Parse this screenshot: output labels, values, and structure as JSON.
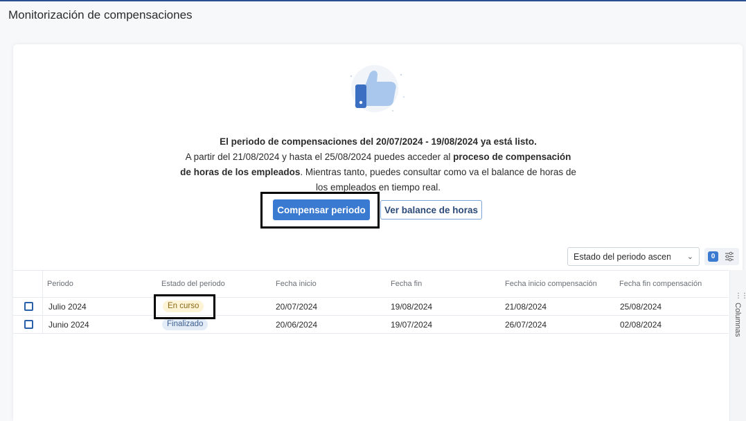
{
  "header": {
    "title": "Monitorización de compensaciones"
  },
  "banner": {
    "headline": "El periodo de compensaciones del 20/07/2024 - 19/08/2024 ya está listo.",
    "body_part1": "A partir del 21/08/2024 y hasta el 25/08/2024 puedes acceder al ",
    "body_bold": "proceso de compensación de horas de los empleados",
    "body_part2": ". Mientras tanto, puedes consultar como va el balance de horas de los empleados en tiempo real.",
    "primary_button": "Compensar periodo",
    "secondary_button": "Ver balance de horas",
    "illustration_icon": "thumbs-up-icon"
  },
  "toolbar": {
    "sort_value": "Estado del periodo ascendente",
    "filter_count": "0",
    "filter_icon": "sliders-icon"
  },
  "table": {
    "headers": [
      "Periodo",
      "Estado del periodo",
      "Fecha inicio",
      "Fecha fin",
      "Fecha inicio compensación",
      "Fecha fin compensación"
    ],
    "rows": [
      {
        "periodo": "Julio 2024",
        "estado": "En curso",
        "fecha_inicio": "20/07/2024",
        "fecha_fin": "19/08/2024",
        "inicio_comp": "21/08/2024",
        "fin_comp": "25/08/2024"
      },
      {
        "periodo": "Junio 2024",
        "estado": "Finalizado",
        "fecha_inicio": "20/06/2024",
        "fecha_fin": "19/07/2024",
        "inicio_comp": "26/07/2024",
        "fin_comp": "02/08/2024"
      }
    ]
  },
  "side_panel": {
    "label": "Columnas",
    "icon": "grid-icon"
  },
  "colors": {
    "accent": "#3a7ad1",
    "status_current_bg": "#fdf3d6",
    "status_done_bg": "#e3ecf7"
  }
}
